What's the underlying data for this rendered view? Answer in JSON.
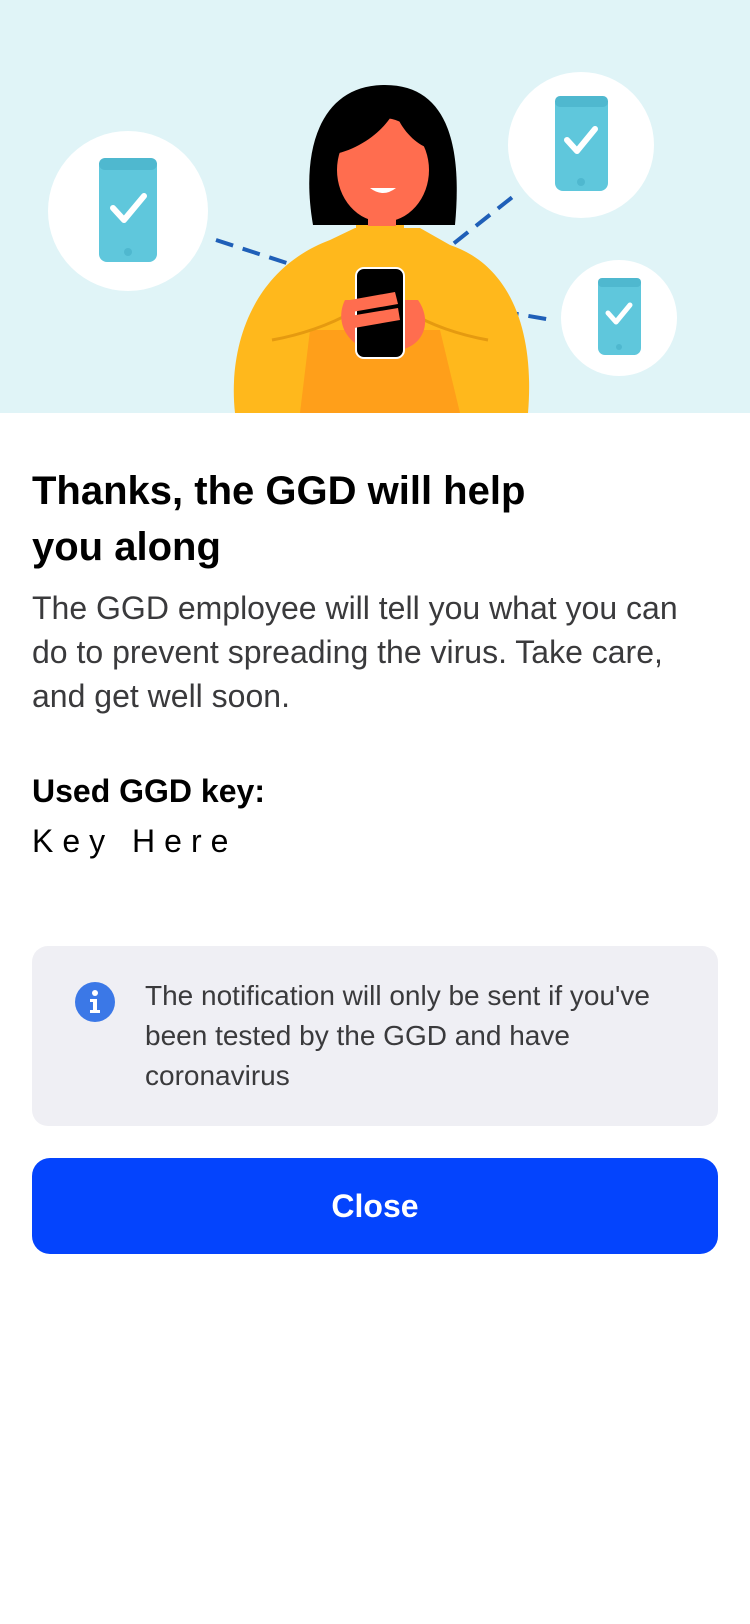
{
  "illustration": {
    "name": "woman-with-phone-illustration",
    "background": "#e0f4f7",
    "phones": [
      "phone-check-icon",
      "phone-check-icon",
      "phone-check-icon"
    ]
  },
  "header": {
    "title": "Thanks, the GGD will help you along"
  },
  "body": {
    "text": "The GGD employee will tell you what you can do to prevent spreading the virus. Take care, and get well soon."
  },
  "key": {
    "label": "Used GGD key:",
    "value": "Key Here"
  },
  "notice": {
    "icon": "info-icon",
    "text": "The notification will only be sent if you've been tested by the GGD and have coronavirus"
  },
  "actions": {
    "close_label": "Close"
  },
  "colors": {
    "accent": "#0444fd",
    "notice_bg": "#efeff4",
    "info_icon": "#3b78e7",
    "phone": "#7fd4e4"
  }
}
